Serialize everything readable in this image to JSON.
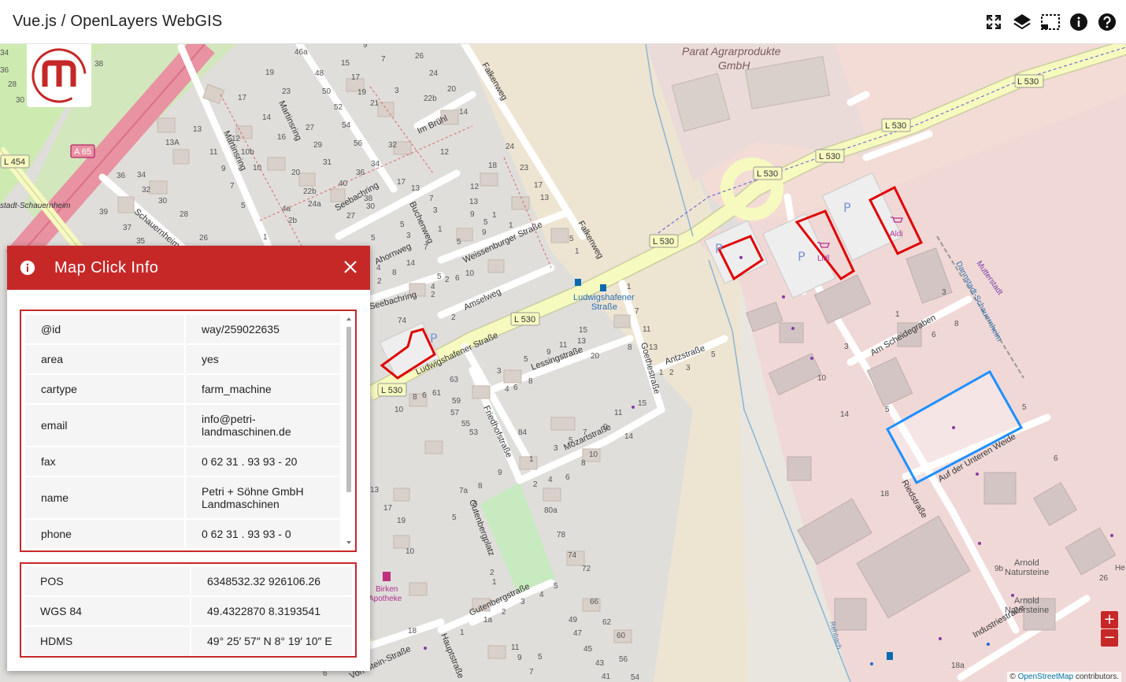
{
  "app": {
    "title": "Vue.js / OpenLayers WebGIS"
  },
  "toolbar": {
    "buttons": [
      {
        "icon": "fullscreen-icon"
      },
      {
        "icon": "layers-icon"
      },
      {
        "icon": "select-area-icon"
      },
      {
        "icon": "info-icon"
      },
      {
        "icon": "help-icon"
      }
    ]
  },
  "map": {
    "labels": {
      "company": "Parat Agrarprodukte",
      "company2": "GmbH",
      "road_l530": "L 530",
      "road_l454": "L 454",
      "road_a65": "A 65",
      "street_ludwigshafener": "Ludwigshafener Straße",
      "stop_ludwigshafener": "Ludwigshafener",
      "stop_strasse": "Straße",
      "street_goethe": "Goethestraße",
      "street_lessing": "Lessingstraße",
      "street_mozart": "Mozartstraße",
      "street_friedhof": "Friedhofstraße",
      "street_gutenbergplatz": "Gutenbergplatz",
      "street_gutenberg": "Gutenbergstraße",
      "street_haupt": "Hauptstraße",
      "street_antz": "Antzstraße",
      "street_riedstrasse": "Riedstraße",
      "street_scheidegraben": "Am Scheidegraben",
      "street_unteren_weide": "Auf der Unteren Weide",
      "street_industrie": "Industriestraße",
      "street_falkenweg": "Falkenweg",
      "street_seebachring": "Seebachring",
      "street_martinsring": "Martinsring",
      "street_schauernheim": "Schauernheim",
      "street_imbruhl": "Im Brühl",
      "street_weissenburger": "Weissenburger Straße",
      "street_amselweg": "Amselweg",
      "street_buchenweg": "Buchenweg",
      "street_ahornweg": "Ahornweg",
      "street_hainstein": "Von-Stein-Straße",
      "aldi": "Aldi",
      "lidl": "Lidl",
      "apotheke1": "Birken",
      "apotheke2": "Apotheke",
      "arnold1": "Arnold",
      "arnold2": "Natursteine",
      "rail": "Dannstadt-Schauernheim",
      "mutterstadt": "Mutterstadt",
      "rehbach": "Rehbach",
      "stadt": "stadt-Schauernheim"
    }
  },
  "panel": {
    "title": "Map Click Info",
    "properties": [
      {
        "key": "@id",
        "value": "way/259022635"
      },
      {
        "key": "area",
        "value": "yes"
      },
      {
        "key": "cartype",
        "value": "farm_machine"
      },
      {
        "key": "email",
        "value": "info@petri-\nlandmaschinen.de"
      },
      {
        "key": "fax",
        "value": "0 62 31 . 93 93 - 20"
      },
      {
        "key": "name",
        "value": "Petri + Söhne GmbH\nLandmaschinen"
      },
      {
        "key": "phone",
        "value": "0 62 31 . 93 93 - 0"
      }
    ],
    "position": [
      {
        "key": "POS",
        "value": "6348532.32 926106.26"
      },
      {
        "key": "WGS 84",
        "value": "49.4322870 8.3193541"
      },
      {
        "key": "HDMS",
        "value": "49° 25′ 57″ N 8° 19′ 10″ E"
      }
    ]
  },
  "zoom": {
    "in": "+",
    "out": "−"
  },
  "attribution": {
    "prefix": "©",
    "link": "OpenStreetMap",
    "suffix": "contributors."
  },
  "colors": {
    "accent": "#c62828",
    "highlight": "#1e90ff"
  }
}
